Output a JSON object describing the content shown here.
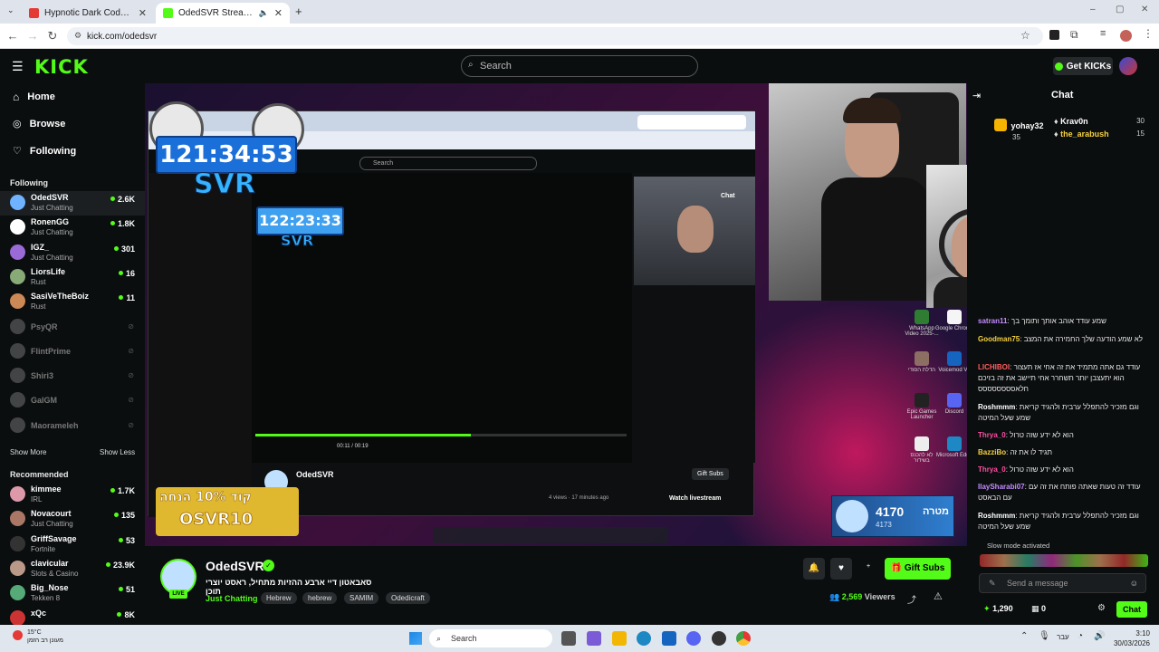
{
  "browser": {
    "tabs": [
      {
        "title": "Hypnotic Dark Code | Futuristic",
        "color": "#e53935",
        "active": false
      },
      {
        "title": "OdedSVR Stream - Watch Live",
        "color": "#53fc18",
        "active": true
      }
    ],
    "url": "kick.com/odedsvr"
  },
  "header": {
    "logo": "KICK",
    "search_placeholder": "Search",
    "get_kicks": "Get KICKs"
  },
  "sidebar": {
    "nav": [
      {
        "label": "Home",
        "icon": "home-icon"
      },
      {
        "label": "Browse",
        "icon": "compass-icon"
      },
      {
        "label": "Following",
        "icon": "heart-icon"
      }
    ],
    "following_title": "Following",
    "following": [
      {
        "name": "OdedSVR",
        "category": "Just Chatting",
        "viewers": "2.6K",
        "online": true,
        "color": "#6fb3ff"
      },
      {
        "name": "RonenGG",
        "category": "Just Chatting",
        "viewers": "1.8K",
        "online": true,
        "color": "#fff"
      },
      {
        "name": "IGZ_",
        "category": "Just Chatting",
        "viewers": "301",
        "online": true,
        "color": "#9a6bd6"
      },
      {
        "name": "LiorsLife",
        "category": "Rust",
        "viewers": "16",
        "online": true,
        "color": "#8a7"
      },
      {
        "name": "SasiVeTheBoiz",
        "category": "Rust",
        "viewers": "11",
        "online": true,
        "color": "#c85"
      },
      {
        "name": "PsyQR",
        "online": false,
        "color": "#888"
      },
      {
        "name": "FlintPrime",
        "online": false,
        "color": "#888"
      },
      {
        "name": "Shiri3",
        "online": false,
        "color": "#888"
      },
      {
        "name": "GalGM",
        "online": false,
        "color": "#888"
      },
      {
        "name": "Maorameleh",
        "online": false,
        "color": "#888"
      }
    ],
    "show_more": "Show More",
    "show_less": "Show Less",
    "recommended_title": "Recommended",
    "recommended": [
      {
        "name": "kimmee",
        "category": "IRL",
        "viewers": "1.7K",
        "color": "#d9a"
      },
      {
        "name": "Novacourt",
        "category": "Just Chatting",
        "viewers": "135",
        "color": "#a76"
      },
      {
        "name": "GriffSavage",
        "category": "Fortnite",
        "viewers": "53",
        "color": "#333"
      },
      {
        "name": "clavicular",
        "category": "Slots & Casino",
        "viewers": "23.9K",
        "color": "#b98"
      },
      {
        "name": "Big_Nose",
        "category": "Tekken 8",
        "viewers": "51",
        "color": "#5a7"
      },
      {
        "name": "xQc",
        "category": "",
        "viewers": "8K",
        "color": "#c33"
      }
    ]
  },
  "stream": {
    "timer_main": "121:34:53",
    "timer_small": "122:23:33",
    "overlay_brand": "SVR",
    "promo_line1": "קוד 10% הנחה",
    "promo_line2": "OSVR10",
    "sub_count": "4170",
    "sub_small": "4173",
    "sub_label": "מטרה",
    "inner_search": "Search",
    "inner_channel": "OdedSVR",
    "inner_gift": "Gift Subs",
    "inner_watch": "Watch livestream",
    "inner_views": "4 views · 17 minutes ago",
    "inner_time": "00:11 / 00:19",
    "inner_chat": "Chat"
  },
  "channel": {
    "name": "OdedSVR",
    "title": "סאבאטון דיי ארבע ההזיות מתחיל, ראסט יוצרי תוכן",
    "category": "Just Chatting",
    "tags": [
      "Hebrew",
      "hebrew",
      "SAMIM",
      "Odedicraft"
    ],
    "viewers": "2,569",
    "viewers_label": "Viewers",
    "gift_subs": "Gift Subs",
    "live_label": "LIVE"
  },
  "chat": {
    "title": "Chat",
    "top": [
      {
        "user": "yohay32",
        "amount": "35"
      },
      {
        "user": "Krav0n",
        "amount": "30"
      },
      {
        "user": "the_arabush",
        "amount": "15"
      }
    ],
    "messages": [
      {
        "user": "satran11",
        "color": "#c38cff",
        "text": "שמע עודד אוהב אותך ותומך בך"
      },
      {
        "user": "Goodman75",
        "color": "#f5d142",
        "text": "לא שמע הודעה שלך החמירה את המצב"
      },
      {
        "user": "LICHIBOI",
        "color": "#ff5c5c",
        "text": "עודד גם אתה מתמיד את זה אחי אז תעצור הוא יתעצבן יותר תשחרר אחי תיישב את זה בזיכם חלאסססססססס"
      },
      {
        "user": "Roshmmm",
        "color": "#ffffff",
        "text": "וגם מזכיר להתפלל ערבית ולהגיד קריאת שמע שעל המיטה"
      },
      {
        "user": "Thrya_0",
        "color": "#ff4fa3",
        "text": "הוא לא ידע שזה טרול"
      },
      {
        "user": "BazziBo",
        "color": "#f5d142",
        "text": "תגיד לו את זה"
      },
      {
        "user": "Thrya_0",
        "color": "#ff4fa3",
        "text": "הוא לא ידע שזה טרול"
      },
      {
        "user": "IlaySharabi07",
        "color": "#c38cff",
        "text": "עודד זה טעות שאתה פותח את זה עם עם הבאסט"
      },
      {
        "user": "Roshmmm",
        "color": "#ffffff",
        "text": "וגם מזכיר להתפלל ערבית ולהגיד קריאת שמע שעל המיטה"
      }
    ],
    "slow_mode": "Slow mode activated",
    "input_placeholder": "Send a message",
    "points": "1,290",
    "subs_count": "0",
    "send_label": "Chat"
  },
  "desktop": {
    "icons": [
      {
        "label": "WhatsApp Video 2025-..."
      },
      {
        "label": "Google Chrome"
      },
      {
        "label": "הדלת הסודי"
      },
      {
        "label": "Voicemod V3"
      },
      {
        "label": "Epic Games Launcher"
      },
      {
        "label": "Discord"
      },
      {
        "label": "לא להכנס בשידור"
      },
      {
        "label": "Microsoft Edge"
      }
    ]
  },
  "taskbar": {
    "weather": "15°C",
    "weather_sub": "מעונן רב הזמן",
    "search": "Search",
    "lang": "עבר",
    "time": "3:10",
    "date": "30/03/2026"
  }
}
